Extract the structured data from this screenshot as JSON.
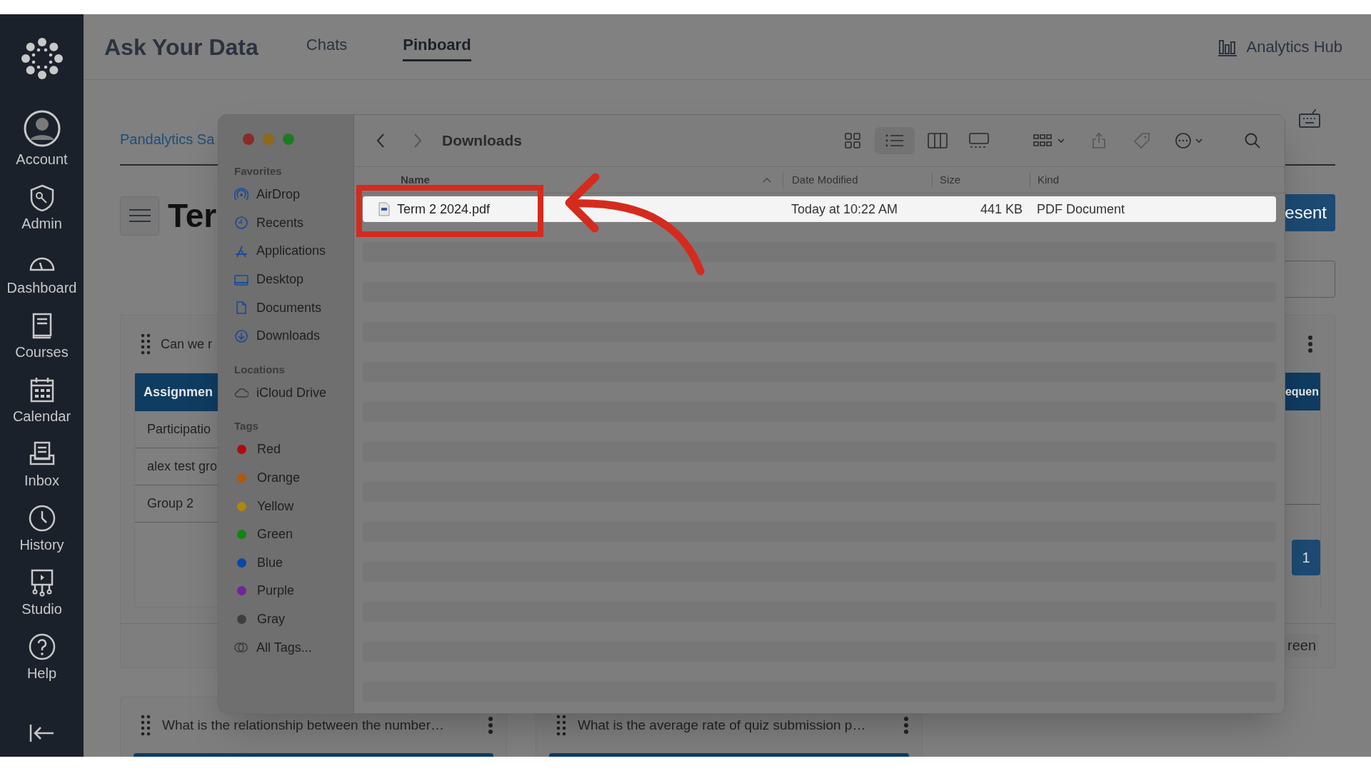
{
  "nav": {
    "items": [
      {
        "label": "Account",
        "kind": "account"
      },
      {
        "label": "Admin",
        "kind": "admin"
      },
      {
        "label": "Dashboard",
        "kind": "dashboard"
      },
      {
        "label": "Courses",
        "kind": "courses"
      },
      {
        "label": "Calendar",
        "kind": "calendar"
      },
      {
        "label": "Inbox",
        "kind": "inbox"
      },
      {
        "label": "History",
        "kind": "history"
      },
      {
        "label": "Studio",
        "kind": "studio"
      },
      {
        "label": "Help",
        "kind": "help"
      }
    ]
  },
  "header": {
    "title": "Ask Your Data",
    "tabs": [
      {
        "label": "Chats",
        "selected": false
      },
      {
        "label": "Pinboard",
        "selected": true
      }
    ],
    "analytics_link": "Analytics Hub"
  },
  "page": {
    "breadcrumb": "Pandalytics Sa",
    "title": "Ter",
    "present_button": "esent",
    "card": {
      "question": "Can we r",
      "table_header": "Assignmen",
      "table_header_right": "equen",
      "rows": [
        "Participatio",
        "alex test gro",
        "Group 2"
      ],
      "page_button": "1",
      "screen_button": "reen"
    },
    "bottom_cards": [
      {
        "question": "What is the relationship between the number…"
      },
      {
        "question": "What is the average rate of quiz submission p…"
      }
    ]
  },
  "finder": {
    "title": "Downloads",
    "sections": [
      {
        "label": "Favorites",
        "items": [
          {
            "label": "AirDrop",
            "kind": "airdrop"
          },
          {
            "label": "Recents",
            "kind": "recents"
          },
          {
            "label": "Applications",
            "kind": "applications"
          },
          {
            "label": "Desktop",
            "kind": "desktop"
          },
          {
            "label": "Documents",
            "kind": "documents"
          },
          {
            "label": "Downloads",
            "kind": "downloads"
          }
        ]
      },
      {
        "label": "Locations",
        "items": [
          {
            "label": "iCloud Drive",
            "kind": "cloud"
          }
        ]
      },
      {
        "label": "Tags",
        "items": [
          {
            "label": "Red",
            "kind": "tag",
            "color": "#b00a0a"
          },
          {
            "label": "Orange",
            "kind": "tag",
            "color": "#b0580c"
          },
          {
            "label": "Yellow",
            "kind": "tag",
            "color": "#b0860c"
          },
          {
            "label": "Green",
            "kind": "tag",
            "color": "#0e870f"
          },
          {
            "label": "Blue",
            "kind": "tag",
            "color": "#0b47a6"
          },
          {
            "label": "Purple",
            "kind": "tag",
            "color": "#702598"
          },
          {
            "label": "Gray",
            "kind": "tag",
            "color": "#3e3e40"
          },
          {
            "label": "All Tags...",
            "kind": "alltags"
          }
        ]
      }
    ],
    "columns": [
      "Name",
      "Date Modified",
      "Size",
      "Kind"
    ],
    "files": [
      {
        "name": "Term 2 2024.pdf",
        "date": "Today at 10:22 AM",
        "size": "441 KB",
        "kind": "PDF Document",
        "selected": true
      }
    ]
  }
}
